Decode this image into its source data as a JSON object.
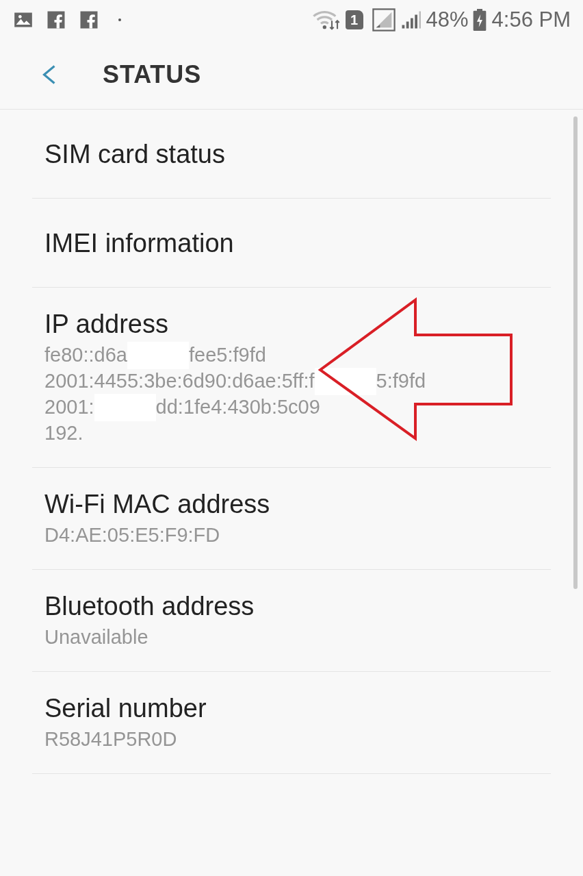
{
  "status_bar": {
    "sim_slot": "1",
    "battery": "48%",
    "time": "4:56 PM"
  },
  "header": {
    "title": "STATUS"
  },
  "items": [
    {
      "title": "SIM card status"
    },
    {
      "title": "IMEI information"
    },
    {
      "title": "IP address",
      "lines": [
        [
          "fe80::d6a",
          "fee5:f9fd"
        ],
        [
          "2001:4455:3be:6d90:d6ae:5ff:f",
          "5:f9fd"
        ],
        [
          "2001:",
          "dd:1fe4:430b:5c09"
        ],
        [
          "192."
        ]
      ]
    },
    {
      "title": "Wi-Fi MAC address",
      "lines": [
        [
          "D4:AE:05:E5:F9:FD"
        ]
      ]
    },
    {
      "title": "Bluetooth address",
      "lines": [
        [
          "Unavailable"
        ]
      ]
    },
    {
      "title": "Serial number",
      "lines": [
        [
          "R58J41P5R0D"
        ]
      ]
    }
  ]
}
